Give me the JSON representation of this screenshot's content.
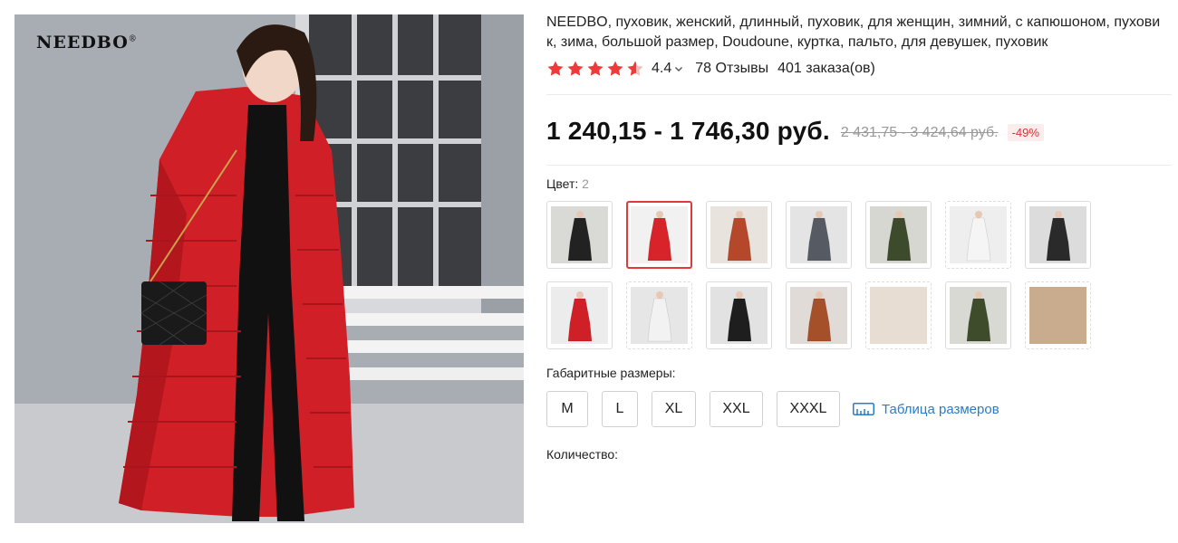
{
  "product": {
    "brand_logo": "NEEDBO",
    "brand_mark": "®",
    "title": "NEEDBO, пуховик, женский, длинный, пуховик, для женщин, зимний, с капюшоном, пуховик, зима, большой размер, Doudoune, куртка, пальто, для девушек, пуховик"
  },
  "rating": {
    "stars": 4.4,
    "value": "4.4",
    "reviews": "78 Отзывы",
    "orders": "401 заказа(ов)",
    "star_color": "#f03a3a"
  },
  "price": {
    "current": "1 240,15 - 1 746,30 руб.",
    "original": "2 431,75 - 3 424,64 руб.",
    "discount": "-49%"
  },
  "color": {
    "label": "Цвет: ",
    "value": "2",
    "selected_index": 1,
    "swatches": [
      {
        "name": "black-fur",
        "bg": "#d9d9d6",
        "coat": "#222222"
      },
      {
        "name": "red",
        "bg": "#f1f1f1",
        "coat": "#d8232a"
      },
      {
        "name": "brown",
        "bg": "#e8e3dd",
        "coat": "#b5482a"
      },
      {
        "name": "grey",
        "bg": "#e4e4e4",
        "coat": "#555a63"
      },
      {
        "name": "army-green",
        "bg": "#d7d7d2",
        "coat": "#3e4a2c"
      },
      {
        "name": "white",
        "bg": "#eeeeee",
        "coat": "#f5f5f5"
      },
      {
        "name": "black",
        "bg": "#dcdcdc",
        "coat": "#2a2a2a"
      },
      {
        "name": "red-2",
        "bg": "#ececec",
        "coat": "#cf2027"
      },
      {
        "name": "white-2",
        "bg": "#e6e6e6",
        "coat": "#f2f2f2"
      },
      {
        "name": "black-2",
        "bg": "#e2e2e2",
        "coat": "#1e1e1e"
      },
      {
        "name": "caramel",
        "bg": "#e0dbd6",
        "coat": "#a6502a"
      },
      {
        "name": "beige",
        "bg": "#e7ddd3",
        "coat": ""
      },
      {
        "name": "green-2",
        "bg": "#d9d9d4",
        "coat": "#3f4c2c"
      },
      {
        "name": "camel",
        "bg": "#c9ab8e",
        "coat": ""
      }
    ]
  },
  "size": {
    "label": "Габаритные размеры:",
    "options": [
      "M",
      "L",
      "XL",
      "XXL",
      "XXXL"
    ],
    "chart_link": "Таблица размеров"
  },
  "quantity": {
    "label": "Количество:"
  },
  "colors": {
    "accent_red": "#e62e2e",
    "link_blue": "#2a7cc7"
  }
}
